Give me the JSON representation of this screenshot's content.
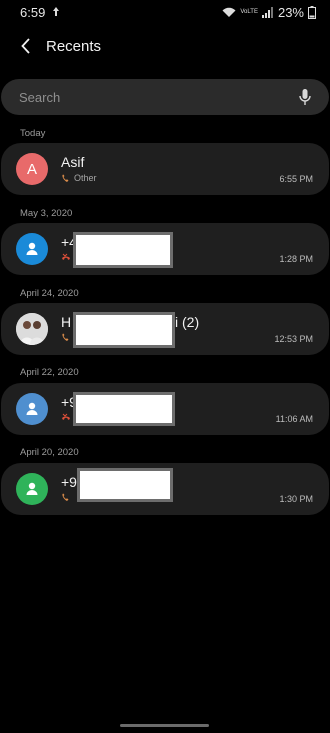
{
  "status_bar": {
    "time": "6:59",
    "battery": "23%",
    "network_label": "VoLTE"
  },
  "header": {
    "title": "Recents"
  },
  "search": {
    "placeholder": "Search"
  },
  "sections": [
    {
      "date": "Today",
      "call": {
        "name": "Asif",
        "type": "Other",
        "time": "6:55 PM",
        "avatar_letter": "A",
        "avatar_color": "#e86a6a",
        "call_icon": "outgoing-call-icon"
      }
    },
    {
      "date": "May 3, 2020",
      "call": {
        "name": "+4",
        "type": "",
        "time": "1:28 PM",
        "avatar_color": "#1a8ad8",
        "call_icon": "missed-call-icon"
      }
    },
    {
      "date": "April 24, 2020",
      "call": {
        "name": "H",
        "name_suffix": "i (2)",
        "type": "",
        "time": "12:53 PM",
        "avatar_color": "#8a8a8a",
        "call_icon": "outgoing-call-icon"
      }
    },
    {
      "date": "April 22, 2020",
      "call": {
        "name": "+9",
        "type": "",
        "time": "11:06 AM",
        "avatar_color": "#4f8fcf",
        "call_icon": "missed-call-icon"
      }
    },
    {
      "date": "April 20, 2020",
      "call": {
        "name": "+9",
        "type": "",
        "time": "1:30 PM",
        "avatar_color": "#2fb35a",
        "call_icon": "outgoing-call-icon"
      }
    }
  ]
}
